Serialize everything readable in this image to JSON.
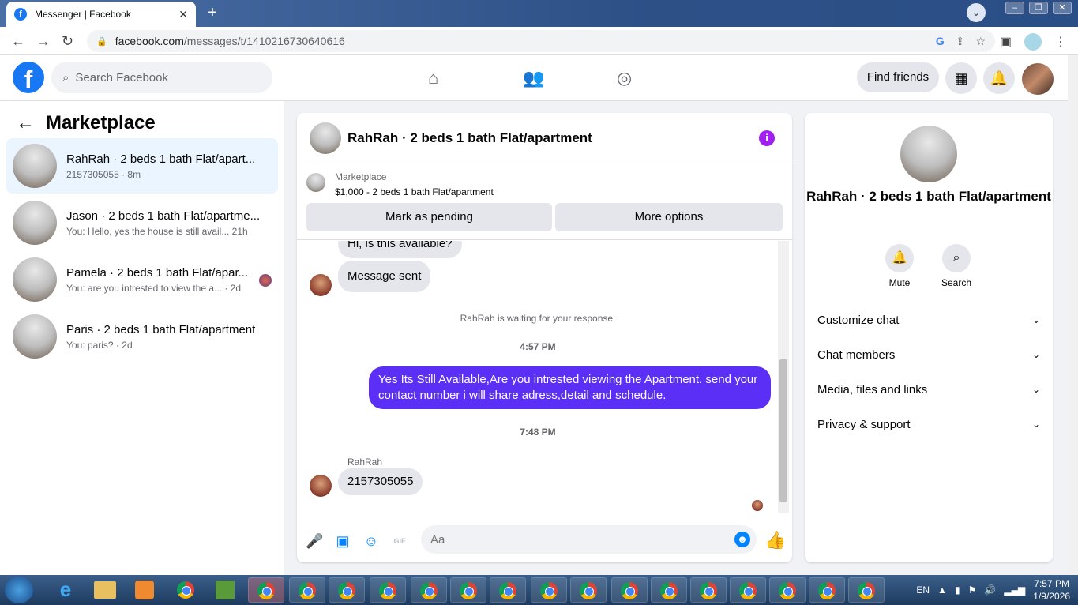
{
  "browser": {
    "tab_title": "Messenger | Facebook",
    "url_host": "facebook.com",
    "url_path": "/messages/t/1410216730640616"
  },
  "fb": {
    "search_placeholder": "Search Facebook",
    "find_friends": "Find friends"
  },
  "left": {
    "title": "Marketplace",
    "conversations": [
      {
        "title": "RahRah · 2 beds 1 bath Flat/apart...",
        "subtitle": "2157305055 · 8m"
      },
      {
        "title": "Jason · 2 beds 1 bath Flat/apartme...",
        "subtitle": "You: Hello, yes the house is still avail...  21h"
      },
      {
        "title": "Pamela · 2 beds 1 bath Flat/apar...",
        "subtitle": "You: are you intrested to view the a... · 2d"
      },
      {
        "title": "Paris · 2 beds 1 bath Flat/apartment",
        "subtitle": "You: paris? · 2d"
      }
    ]
  },
  "chat": {
    "title": "RahRah · 2 beds 1 bath Flat/apartment",
    "listing_source": "Marketplace",
    "listing_desc": "$1,000 - 2 beds 1 bath Flat/apartment",
    "mark_pending": "Mark as pending",
    "more_options": "More options",
    "msg1": "Hi, is this available?",
    "msg2": "Message sent",
    "system": "RahRah is waiting for your response.",
    "time1": "4:57 PM",
    "out_msg": "Yes Its Still Available,Are you intrested viewing the Apartment. send your contact number i will share adress,detail and schedule.",
    "time2": "7:48 PM",
    "sender": "RahRah",
    "msg3": "2157305055",
    "input_placeholder": "Aa",
    "gif_label": "GIF"
  },
  "right": {
    "title": "RahRah · 2 beds 1 bath Flat/apartment",
    "mute": "Mute",
    "search": "Search",
    "rows": [
      "Customize chat",
      "Chat members",
      "Media, files and links",
      "Privacy & support"
    ]
  },
  "taskbar": {
    "lang": "EN",
    "time": "7:57 PM",
    "date": "1/9/2026"
  }
}
